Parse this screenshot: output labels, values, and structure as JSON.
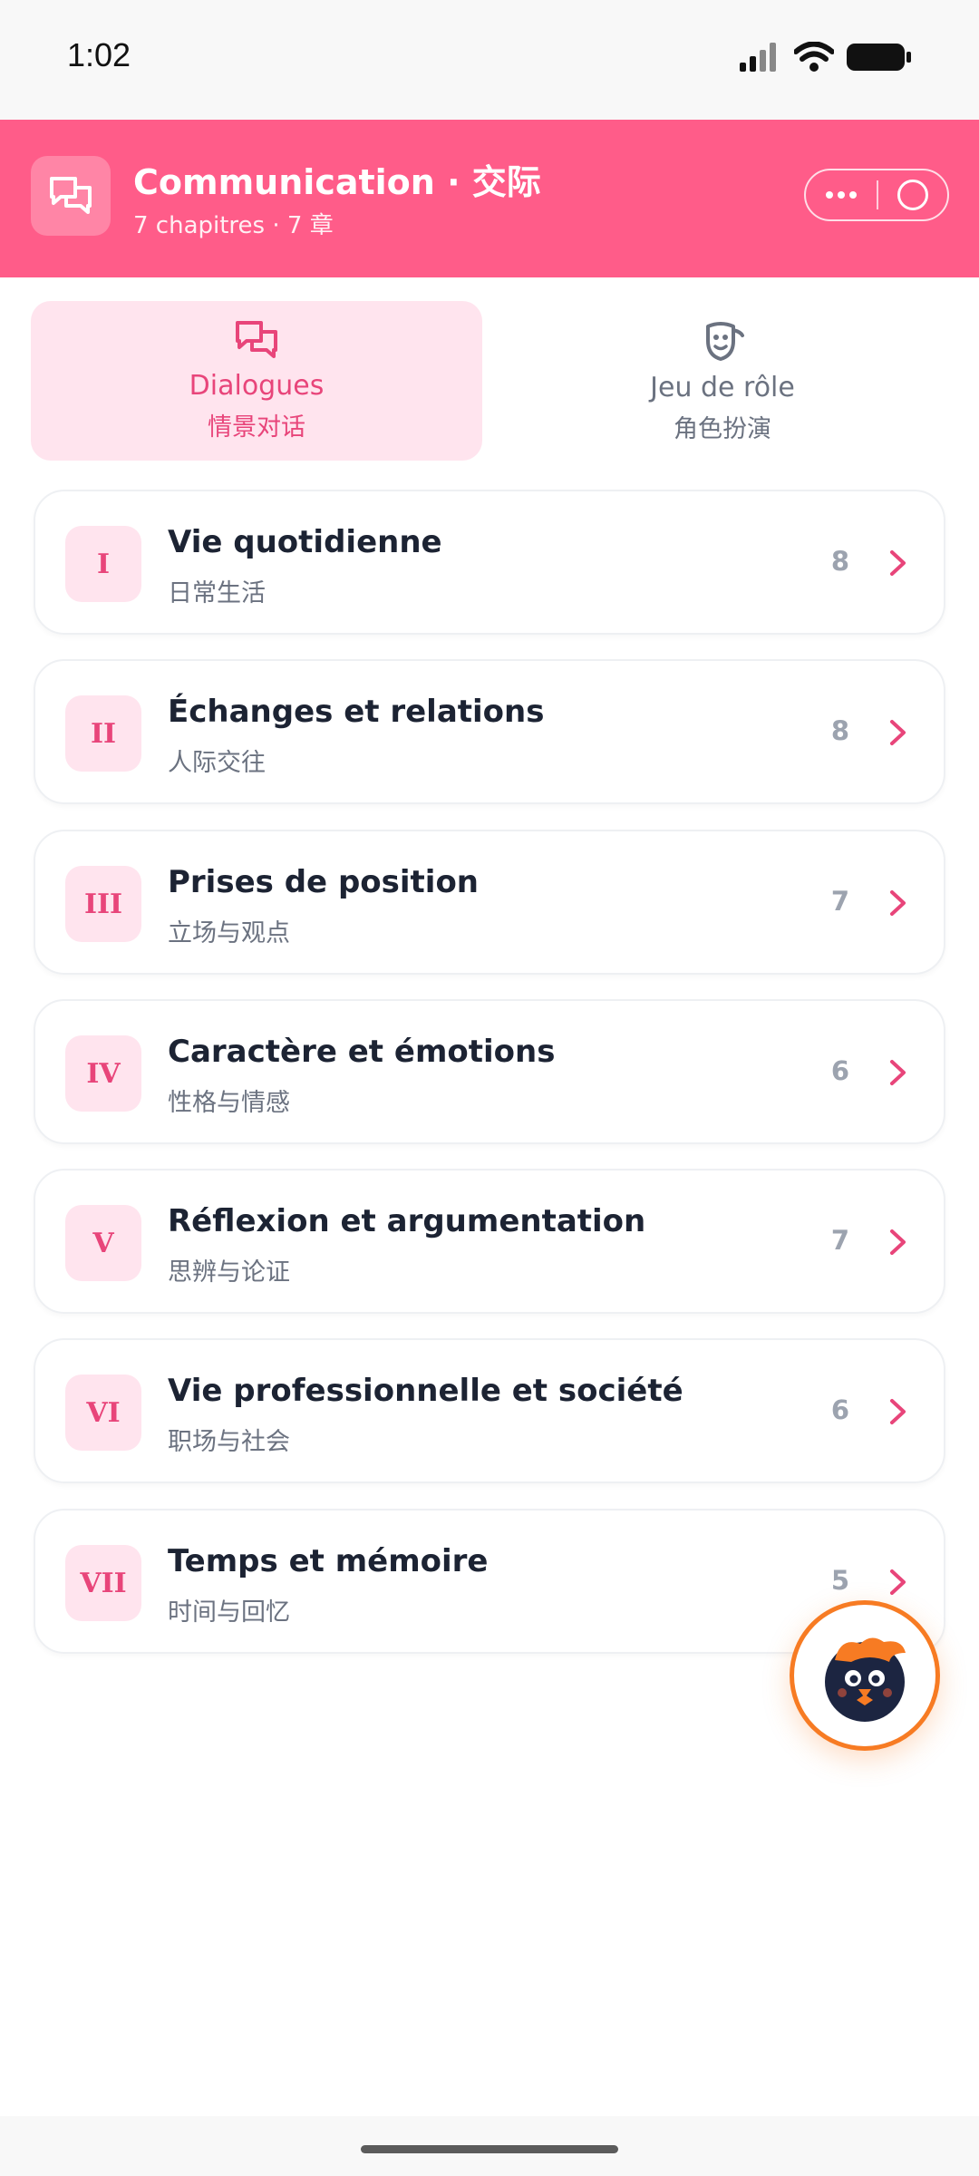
{
  "status_bar": {
    "time": "1:02"
  },
  "header": {
    "title": "Communication · 交际",
    "subtitle": "7 chapitres · 7 章",
    "icon": "chat-bubbles-icon",
    "accent_color": "#ff5c89"
  },
  "tabs": [
    {
      "label_fr": "Dialogues",
      "label_zh": "情景对话",
      "icon": "chat-bubbles-icon",
      "active": true
    },
    {
      "label_fr": "Jeu de rôle",
      "label_zh": "角色扮演",
      "icon": "theater-masks-icon",
      "active": false
    }
  ],
  "chapters": [
    {
      "numeral": "I",
      "title": "Vie quotidienne",
      "subtitle": "日常生活",
      "count": "8"
    },
    {
      "numeral": "II",
      "title": "Échanges et relations",
      "subtitle": "人际交往",
      "count": "8"
    },
    {
      "numeral": "III",
      "title": "Prises de position",
      "subtitle": "立场与观点",
      "count": "7"
    },
    {
      "numeral": "IV",
      "title": "Caractère et émotions",
      "subtitle": "性格与情感",
      "count": "6"
    },
    {
      "numeral": "V",
      "title": "Réflexion et argumentation",
      "subtitle": "思辨与论证",
      "count": "7"
    },
    {
      "numeral": "VI",
      "title": "Vie professionnelle et société",
      "subtitle": "职场与社会",
      "count": "6"
    },
    {
      "numeral": "VII",
      "title": "Temps et mémoire",
      "subtitle": "时间与回忆",
      "count": "5"
    }
  ],
  "fab": {
    "icon": "owl-mascot-icon",
    "ring_color": "#f77b23"
  }
}
